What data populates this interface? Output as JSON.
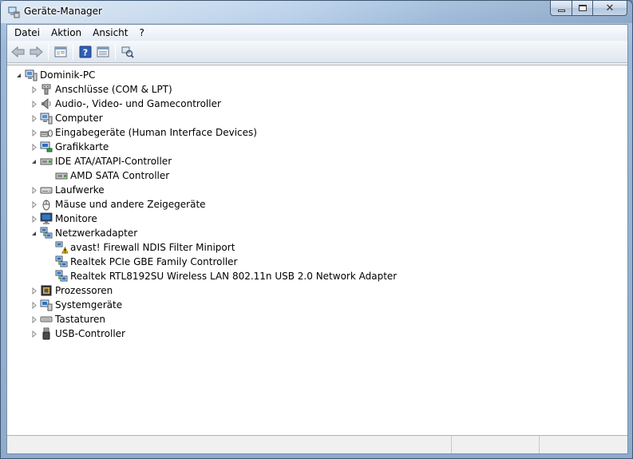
{
  "window": {
    "title": "Geräte-Manager"
  },
  "menubar": {
    "items": [
      "Datei",
      "Aktion",
      "Ansicht",
      "?"
    ]
  },
  "toolbar": {
    "buttons": [
      "back-icon",
      "forward-icon",
      "properties-view-icon",
      "help-icon",
      "console-tree-icon",
      "scan-hardware-icon"
    ]
  },
  "tree": {
    "root": {
      "label": "Dominik-PC",
      "icon": "computer-icon",
      "expanded": true
    },
    "categories": [
      {
        "label": "Anschlüsse (COM & LPT)",
        "icon": "port-icon",
        "expanded": false
      },
      {
        "label": "Audio-, Video- und Gamecontroller",
        "icon": "speaker-icon",
        "expanded": false
      },
      {
        "label": "Computer",
        "icon": "computer-icon",
        "expanded": false
      },
      {
        "label": "Eingabegeräte (Human Interface Devices)",
        "icon": "hid-icon",
        "expanded": false
      },
      {
        "label": "Grafikkarte",
        "icon": "display-adapter-icon",
        "expanded": false
      },
      {
        "label": "IDE ATA/ATAPI-Controller",
        "icon": "ide-controller-icon",
        "expanded": true,
        "children": [
          {
            "label": "AMD SATA Controller",
            "icon": "ide-controller-icon"
          }
        ]
      },
      {
        "label": "Laufwerke",
        "icon": "drive-icon",
        "expanded": false
      },
      {
        "label": "Mäuse und andere Zeigegeräte",
        "icon": "mouse-icon",
        "expanded": false
      },
      {
        "label": "Monitore",
        "icon": "monitor-icon",
        "expanded": false
      },
      {
        "label": "Netzwerkadapter",
        "icon": "network-icon",
        "expanded": true,
        "children": [
          {
            "label": "avast! Firewall NDIS Filter Miniport",
            "icon": "network-warning-icon"
          },
          {
            "label": "Realtek PCIe GBE Family Controller",
            "icon": "network-icon"
          },
          {
            "label": "Realtek RTL8192SU Wireless LAN 802.11n USB 2.0 Network Adapter",
            "icon": "network-icon"
          }
        ]
      },
      {
        "label": "Prozessoren",
        "icon": "processor-icon",
        "expanded": false
      },
      {
        "label": "Systemgeräte",
        "icon": "system-device-icon",
        "expanded": false
      },
      {
        "label": "Tastaturen",
        "icon": "keyboard-icon",
        "expanded": false
      },
      {
        "label": "USB-Controller",
        "icon": "usb-icon",
        "expanded": false
      }
    ]
  },
  "statusbar": {
    "cells": [
      "",
      "",
      ""
    ]
  }
}
